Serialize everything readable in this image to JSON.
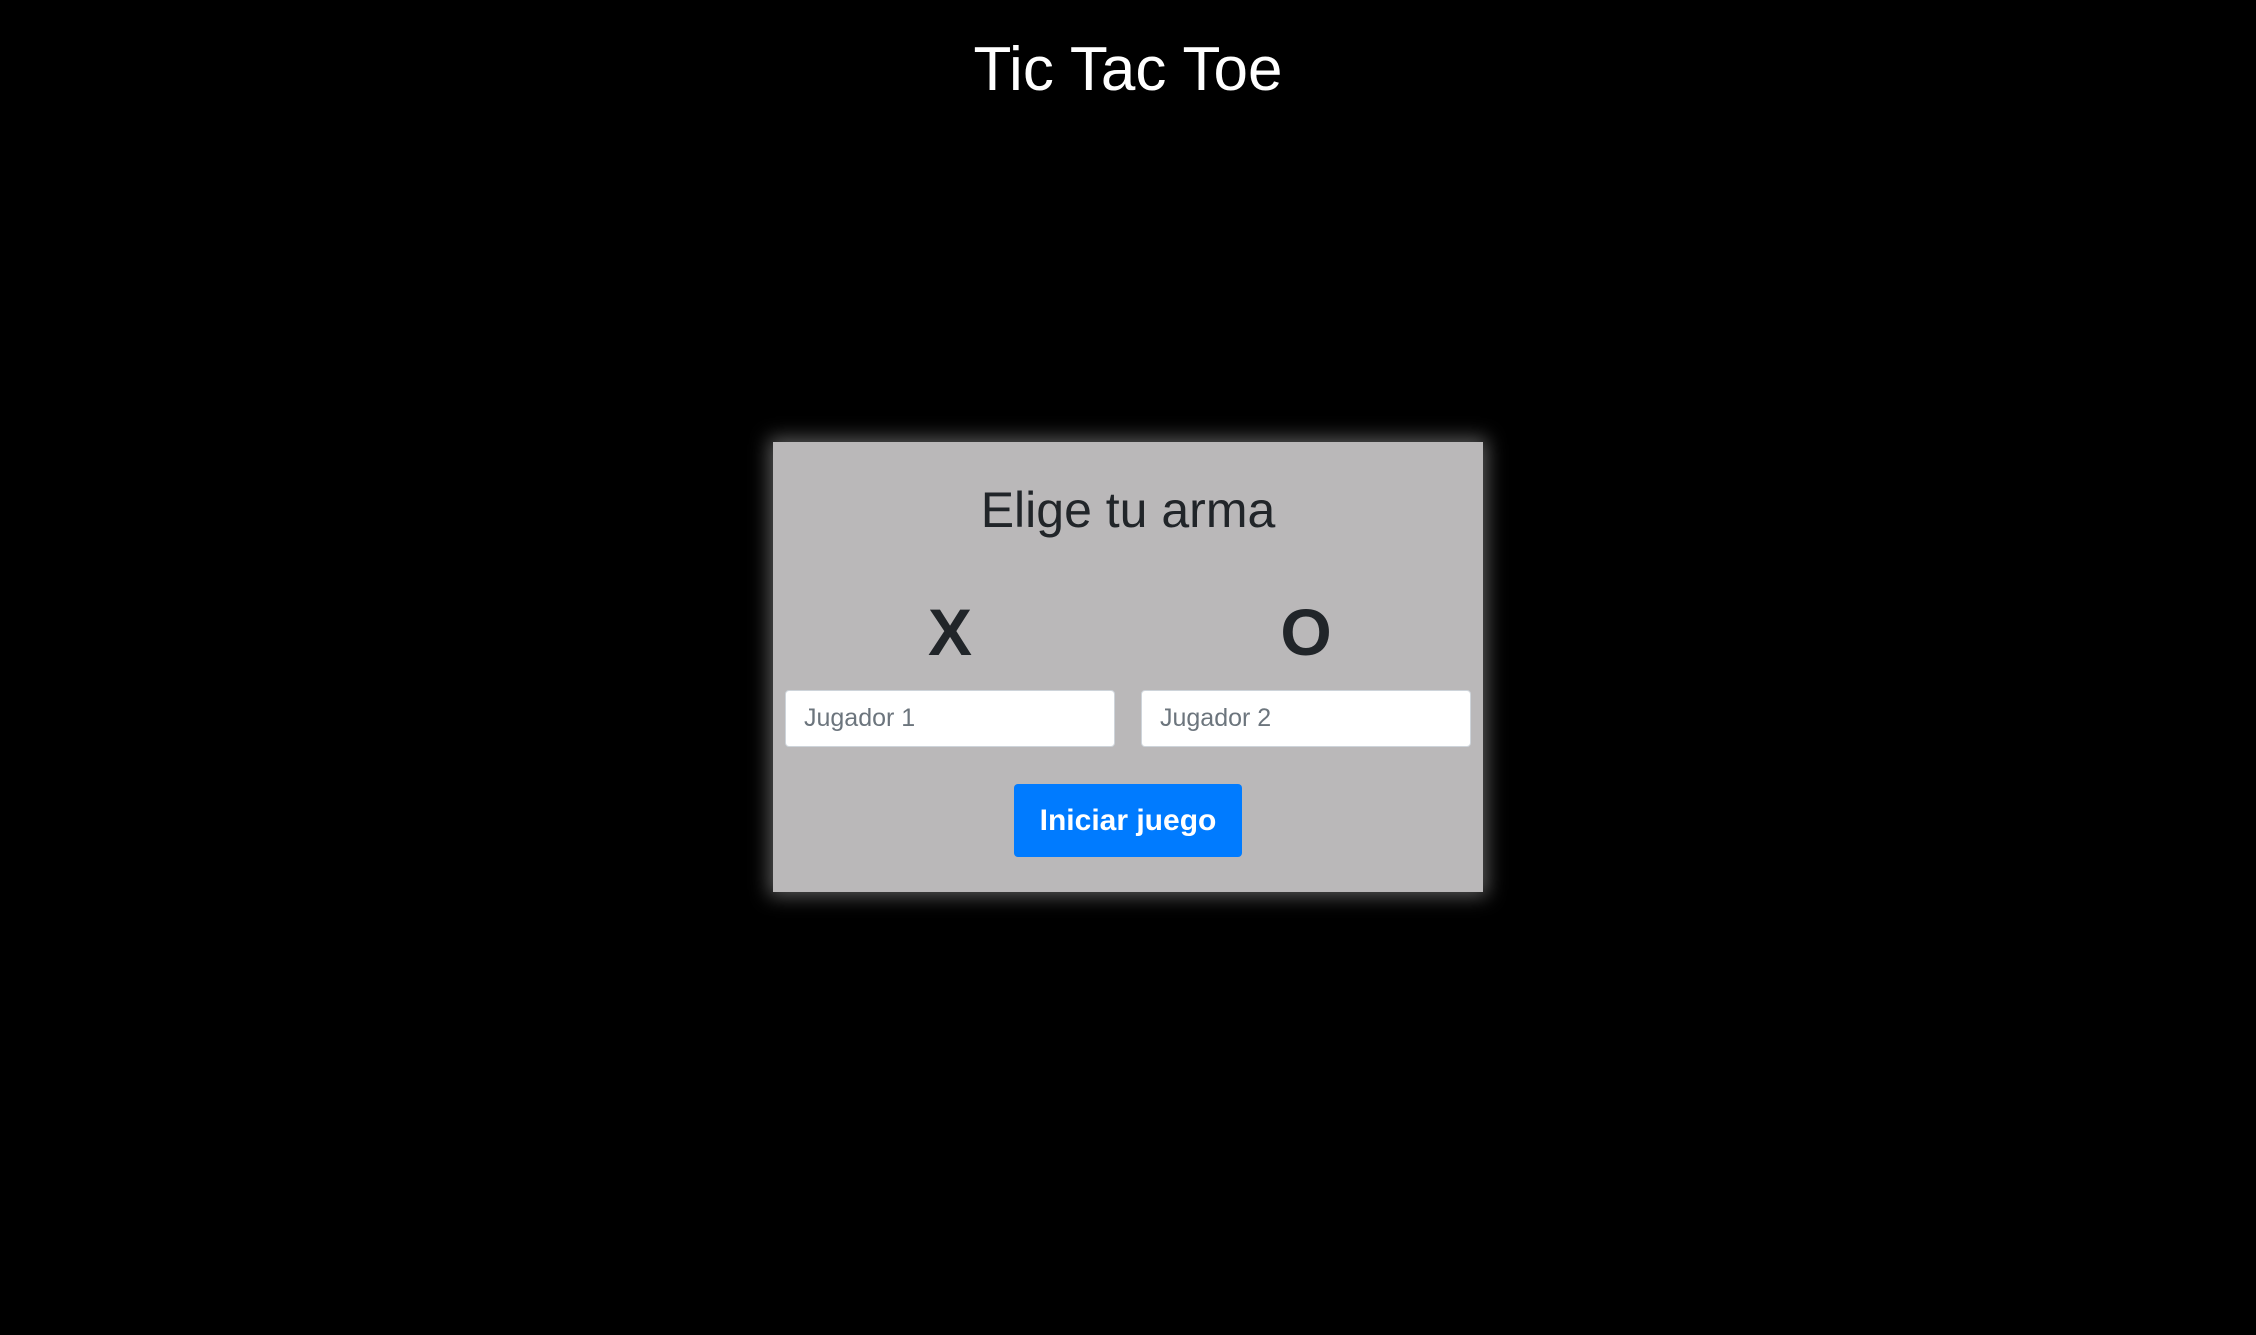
{
  "app": {
    "title": "Tic Tac Toe"
  },
  "modal": {
    "heading": "Elige tu arma",
    "players": [
      {
        "symbol": "X",
        "placeholder": "Jugador 1",
        "value": ""
      },
      {
        "symbol": "O",
        "placeholder": "Jugador 2",
        "value": ""
      }
    ],
    "start_label": "Iniciar juego"
  },
  "colors": {
    "background": "#000000",
    "modal_background": "#bab8b9",
    "button_primary": "#007bff",
    "text_dark": "#212529",
    "title_text": "#ffffff"
  }
}
